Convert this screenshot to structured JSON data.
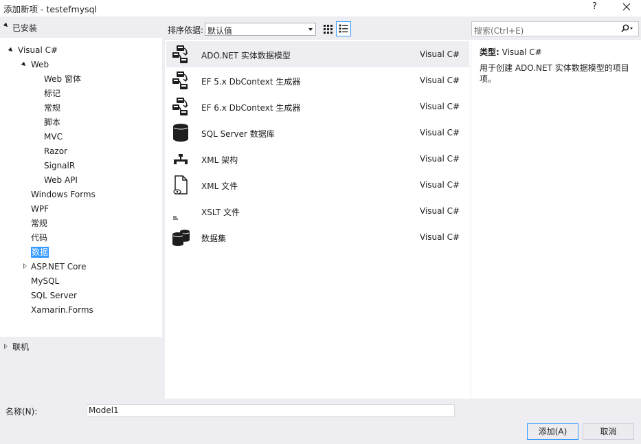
{
  "window": {
    "title": "添加新项 - testefmysql",
    "help": "?"
  },
  "left": {
    "installed": "已安装",
    "online": "联机",
    "tree": [
      {
        "label": "Visual C#",
        "level": 0,
        "expander": "open"
      },
      {
        "label": "Web",
        "level": 1,
        "expander": "open"
      },
      {
        "label": "Web 窗体",
        "level": 2
      },
      {
        "label": "标记",
        "level": 2
      },
      {
        "label": "常规",
        "level": 2
      },
      {
        "label": "脚本",
        "level": 2
      },
      {
        "label": "MVC",
        "level": 2
      },
      {
        "label": "Razor",
        "level": 2
      },
      {
        "label": "SignalR",
        "level": 2
      },
      {
        "label": "Web API",
        "level": 2
      },
      {
        "label": "Windows Forms",
        "level": 1
      },
      {
        "label": "WPF",
        "level": 1
      },
      {
        "label": "常规",
        "level": 1
      },
      {
        "label": "代码",
        "level": 1
      },
      {
        "label": "数据",
        "level": 1,
        "selected": true
      },
      {
        "label": "ASP.NET Core",
        "level": 1,
        "expander": "closed"
      },
      {
        "label": "MySQL",
        "level": 1
      },
      {
        "label": "SQL Server",
        "level": 1
      },
      {
        "label": "Xamarin.Forms",
        "level": 1
      }
    ]
  },
  "sort": {
    "label": "排序依据:",
    "value": "默认值"
  },
  "templates": [
    {
      "name": "ADO.NET 实体数据模型",
      "lang": "Visual C#",
      "icon": "entity-model-icon",
      "selected": true
    },
    {
      "name": "EF 5.x DbContext 生成器",
      "lang": "Visual C#",
      "icon": "entity-model-icon"
    },
    {
      "name": "EF 6.x DbContext 生成器",
      "lang": "Visual C#",
      "icon": "entity-model-icon"
    },
    {
      "name": "SQL Server 数据库",
      "lang": "Visual C#",
      "icon": "database-icon"
    },
    {
      "name": "XML 架构",
      "lang": "Visual C#",
      "icon": "xml-schema-icon"
    },
    {
      "name": "XML 文件",
      "lang": "Visual C#",
      "icon": "xml-file-icon"
    },
    {
      "name": "XSLT 文件",
      "lang": "Visual C#",
      "icon": "xslt-file-icon"
    },
    {
      "name": "数据集",
      "lang": "Visual C#",
      "icon": "dataset-icon"
    }
  ],
  "search": {
    "placeholder": "搜索(Ctrl+E)"
  },
  "description": {
    "type_label": "类型:",
    "type_value": "Visual C#",
    "text": "用于创建 ADO.NET 实体数据模型的项目项。"
  },
  "bottom": {
    "name_label": "名称(N):",
    "name_value": "Model1",
    "add_label": "添加(A)",
    "cancel_label": "取消"
  },
  "colors": {
    "selection": "#3399ff",
    "background": "#eeeef2",
    "icon": "#1e1e1e"
  }
}
